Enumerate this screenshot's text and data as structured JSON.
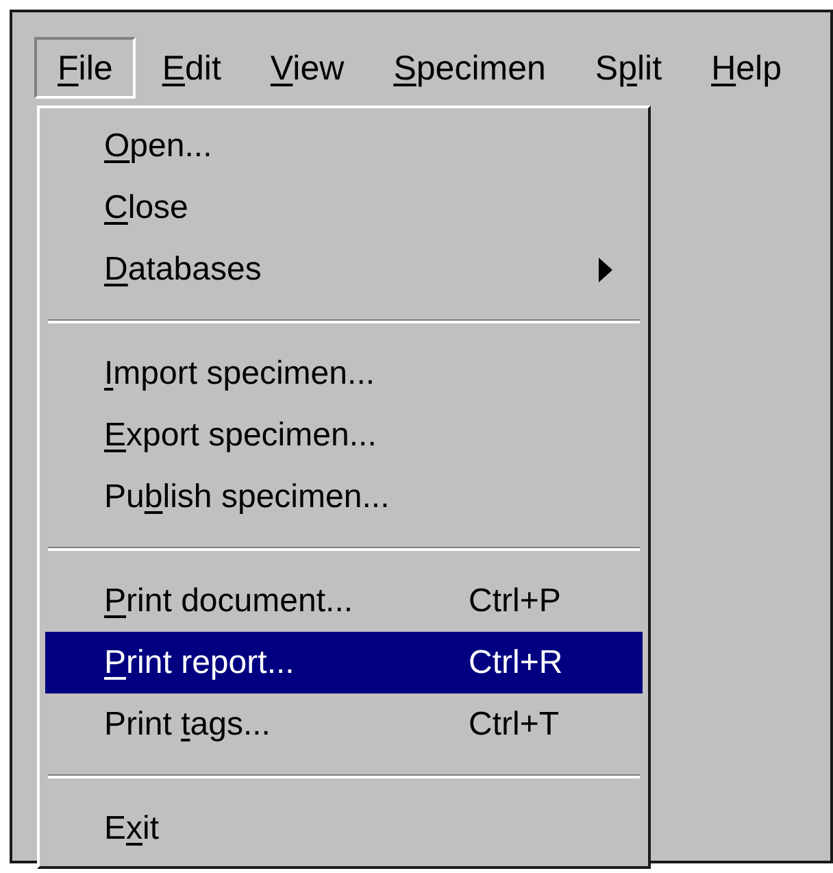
{
  "menu_bar": [
    {
      "label": "File",
      "underline": [
        true,
        false,
        false,
        false
      ],
      "selected": true
    },
    {
      "label": "Edit",
      "underline": [
        true,
        false,
        false,
        false
      ],
      "selected": false
    },
    {
      "label": "View",
      "underline": [
        true,
        false,
        false,
        false
      ],
      "selected": false
    },
    {
      "label": "Specimen",
      "underline": [
        true,
        false,
        false,
        false,
        false,
        false,
        false,
        false
      ],
      "selected": false
    },
    {
      "label": "Split",
      "underline": [
        false,
        true,
        false,
        false,
        false
      ],
      "selected": false
    },
    {
      "label": "Help",
      "underline": [
        true,
        false,
        false,
        false
      ],
      "selected": false
    }
  ],
  "file_menu": [
    {
      "kind": "item",
      "label": "Open...",
      "underline": [
        true,
        false,
        false,
        false,
        false,
        false,
        false
      ],
      "selected": false
    },
    {
      "kind": "item",
      "label": "Close",
      "underline": [
        true,
        false,
        false,
        false,
        false
      ],
      "selected": false
    },
    {
      "kind": "item",
      "label": "Databases",
      "underline": [
        true,
        false,
        false,
        false,
        false,
        false,
        false,
        false,
        false
      ],
      "submenu": true,
      "selected": false
    },
    {
      "kind": "separator"
    },
    {
      "kind": "item",
      "label": "Import specimen...",
      "underline": [
        true,
        false,
        false,
        false,
        false,
        false,
        false,
        false,
        false,
        false,
        false,
        false,
        false,
        false,
        false,
        false,
        false,
        false
      ],
      "selected": false
    },
    {
      "kind": "item",
      "label": "Export specimen...",
      "underline": [
        true,
        false,
        false,
        false,
        false,
        false,
        false,
        false,
        false,
        false,
        false,
        false,
        false,
        false,
        false,
        false,
        false,
        false
      ],
      "selected": false
    },
    {
      "kind": "item",
      "label": "Publish specimen...",
      "underline": [
        false,
        false,
        true,
        false,
        false,
        false,
        false,
        false,
        false,
        false,
        false,
        false,
        false,
        false,
        false,
        false,
        false,
        false,
        false
      ],
      "selected": false
    },
    {
      "kind": "separator"
    },
    {
      "kind": "item",
      "label": "Print document...",
      "underline": [
        true,
        false,
        false,
        false,
        false,
        false,
        false,
        false,
        false,
        false,
        false,
        false,
        false,
        false,
        false,
        false,
        false
      ],
      "shortcut": "Ctrl+P",
      "selected": false
    },
    {
      "kind": "item",
      "label": "Print report...",
      "underline": [
        true,
        false,
        false,
        false,
        false,
        false,
        false,
        false,
        false,
        false,
        false,
        false,
        false,
        false,
        false
      ],
      "shortcut": "Ctrl+R",
      "selected": true
    },
    {
      "kind": "item",
      "label": "Print tags...",
      "underline": [
        false,
        false,
        false,
        false,
        false,
        false,
        true,
        false,
        false,
        false,
        false,
        false,
        false
      ],
      "shortcut": "Ctrl+T",
      "selected": false
    },
    {
      "kind": "separator"
    },
    {
      "kind": "item",
      "label": "Exit",
      "underline": [
        false,
        true,
        false,
        false
      ],
      "selected": false
    }
  ]
}
